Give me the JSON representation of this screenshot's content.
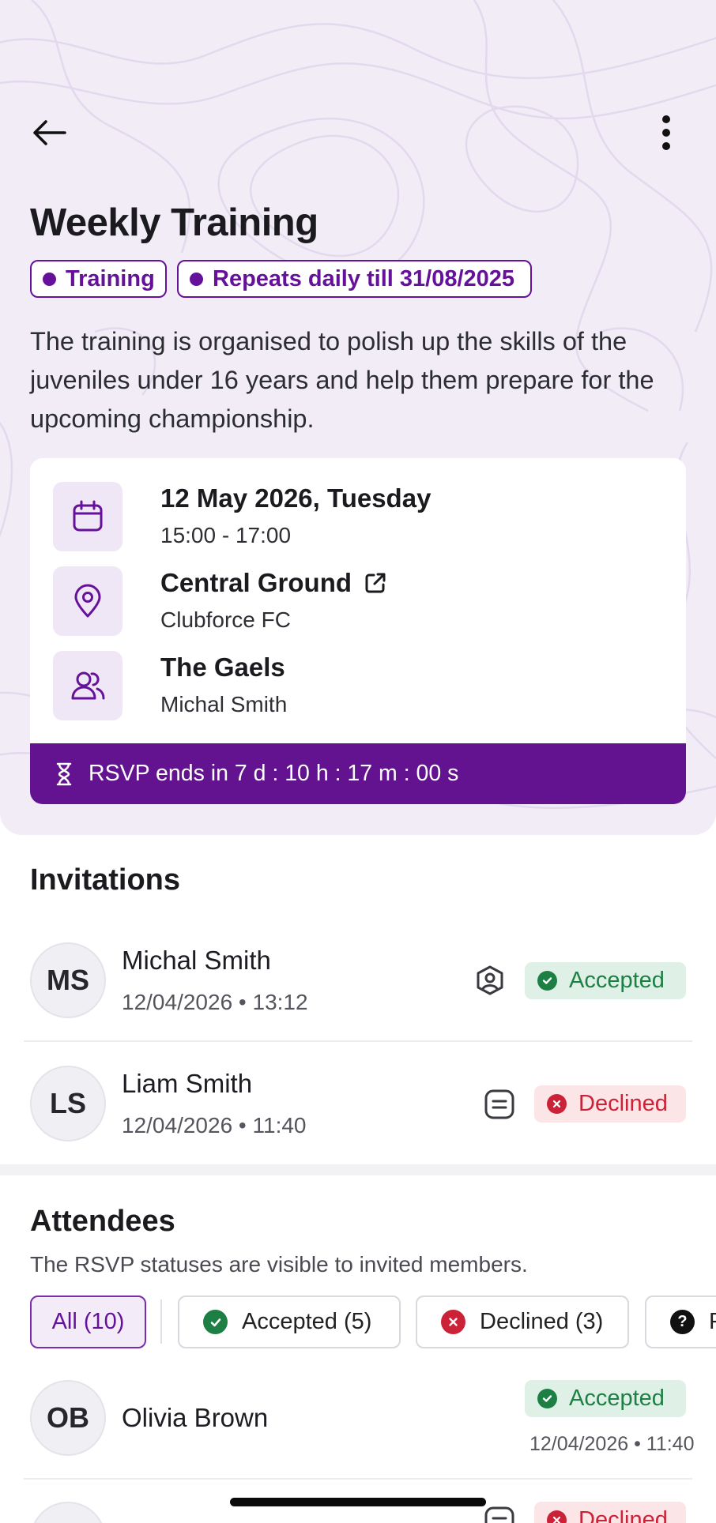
{
  "colors": {
    "brand": "#65119a",
    "rsvp_bar": "#63138f",
    "hero_bg": "#f1ecf5",
    "accepted": "#1e7f45",
    "declined": "#cc2237"
  },
  "header": {
    "back_icon": "arrow-left-icon",
    "more_icon": "vertical-ellipsis-icon"
  },
  "event": {
    "title": "Weekly Training",
    "type_chip": "Training",
    "repeat_chip": "Repeats daily till 31/08/2025",
    "description": "The training is organised to polish up the skills of the juveniles under 16 years and help them prepare for the upcoming championship.",
    "date": "12 May 2026, Tuesday",
    "time": "15:00 - 17:00",
    "venue": "Central Ground",
    "club": "Clubforce FC",
    "team": "The Gaels",
    "organiser": "Michal Smith",
    "rsvp_text": "RSVP ends in 7 d : 10 h : 17 m : 00 s"
  },
  "invitations": {
    "title": "Invitations",
    "items": [
      {
        "initials": "MS",
        "name": "Michal Smith",
        "time": "12/04/2026 • 13:12",
        "role_icon": "user-shield-icon",
        "status": "Accepted"
      },
      {
        "initials": "LS",
        "name": "Liam Smith",
        "time": "12/04/2026 • 11:40",
        "role_icon": "note-icon",
        "status": "Declined"
      }
    ]
  },
  "attendees": {
    "title": "Attendees",
    "subtitle": "The RSVP statuses are visible to invited members.",
    "filters": [
      "All (10)",
      "Accepted (5)",
      "Declined (3)",
      "P"
    ],
    "items": [
      {
        "initials": "OB",
        "name": "Olivia Brown",
        "status": "Accepted",
        "time": "12/04/2026 • 11:40"
      },
      {
        "status": "Declined"
      }
    ]
  }
}
